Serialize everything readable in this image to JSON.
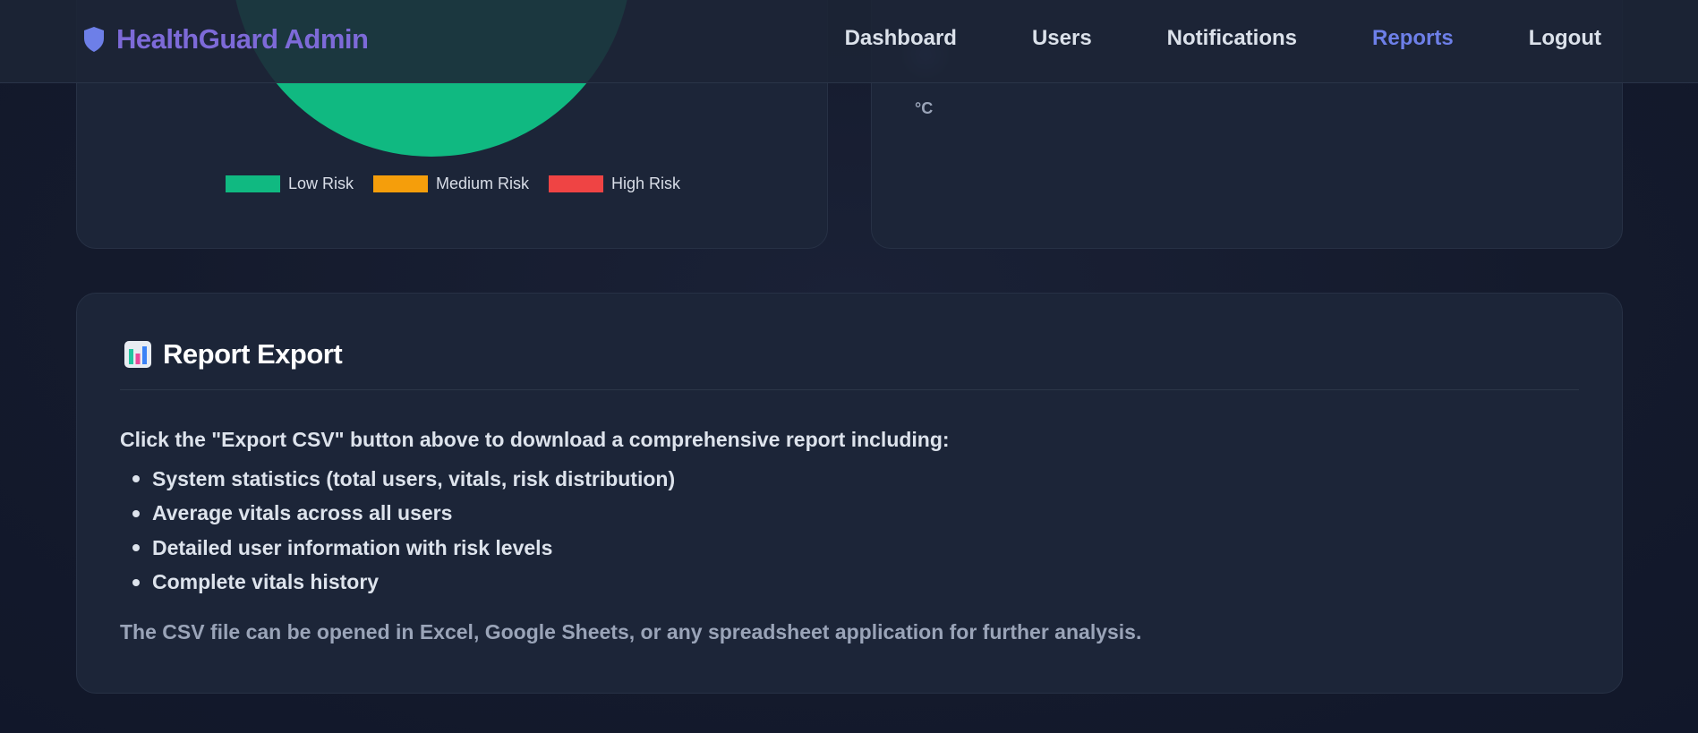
{
  "nav": {
    "brand": "HealthGuard Admin",
    "brand_icon": "shield-icon",
    "items": [
      {
        "label": "Dashboard",
        "active": false
      },
      {
        "label": "Users",
        "active": false
      },
      {
        "label": "Notifications",
        "active": false
      },
      {
        "label": "Reports",
        "active": true
      },
      {
        "label": "Logout",
        "active": false
      }
    ]
  },
  "chart_data": {
    "type": "pie",
    "categories": [
      "Low Risk",
      "Medium Risk",
      "High Risk"
    ],
    "values": [
      75,
      25,
      0
    ],
    "colors": [
      "#10b981",
      "#f59e0b",
      "#ef4444"
    ],
    "legend_position": "bottom"
  },
  "vitals": {
    "unit": "°C"
  },
  "export": {
    "icon": "bar-chart-icon",
    "title": "Report Export",
    "intro": "Click the \"Export CSV\" button above to download a comprehensive report including:",
    "items": [
      "System statistics (total users, vitals, risk distribution)",
      "Average vitals across all users",
      "Detailed user information with risk levels",
      "Complete vitals history"
    ],
    "footnote": "The CSV file can be opened in Excel, Google Sheets, or any spreadsheet application for further analysis."
  },
  "colors": {
    "accent": "#6d7fe8",
    "brand": "#7d6ad8",
    "background": "#141a2c",
    "card": "#1c2538"
  }
}
